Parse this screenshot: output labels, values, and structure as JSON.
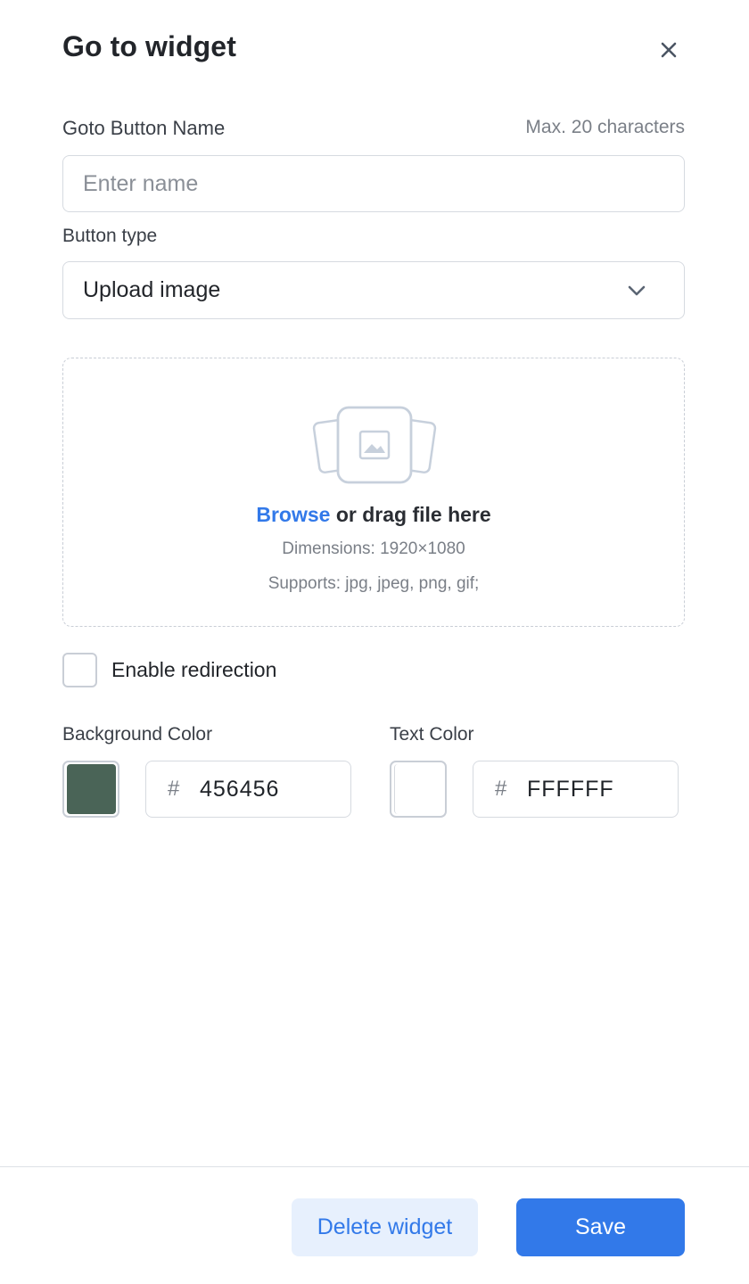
{
  "header": {
    "title": "Go to widget",
    "close_icon": "close-icon"
  },
  "name_field": {
    "label": "Goto Button Name",
    "hint": "Max. 20 characters",
    "value": "",
    "placeholder": "Enter name"
  },
  "button_type": {
    "label": "Button type",
    "selected": "Upload image",
    "icon": "chevron-down-icon"
  },
  "upload": {
    "icon": "image-icon",
    "browse_label": "Browse",
    "drag_text": " or drag file here",
    "dimensions": "Dimensions: 1920×1080",
    "supports": "Supports: jpg, jpeg, png, gif;"
  },
  "redirection": {
    "label": "Enable redirection",
    "checked": false
  },
  "background_color": {
    "label": "Background Color",
    "hash": "#",
    "hex": "456456",
    "swatch": "#4a6457"
  },
  "text_color": {
    "label": "Text Color",
    "hash": "#",
    "hex": "FFFFFF",
    "swatch": "#ffffff"
  },
  "footer": {
    "delete_label": "Delete widget",
    "save_label": "Save"
  },
  "colors": {
    "accent": "#3279e9",
    "accent_light": "#e7f0fd",
    "border": "#d6dae0"
  }
}
